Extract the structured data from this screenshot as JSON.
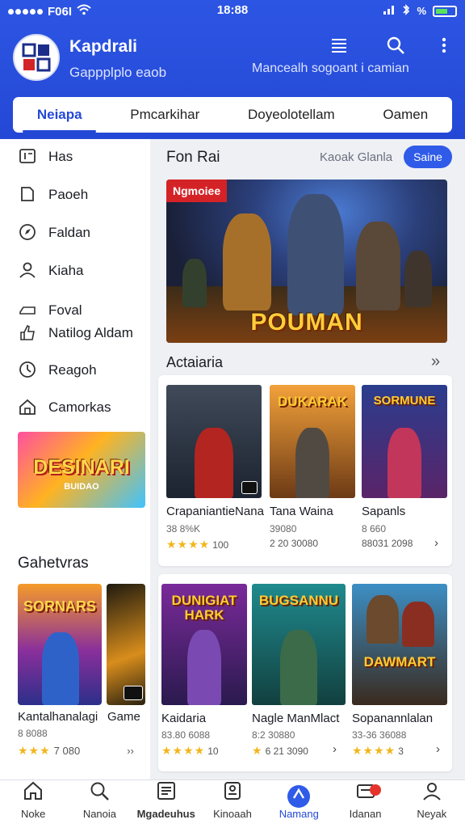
{
  "status_bar": {
    "carrier": "F06I",
    "time": "18:88",
    "battery_text": "%"
  },
  "header": {
    "logo_text": "B B",
    "title": "Kapdrali",
    "subtitle": "Gappplplo eaob",
    "right_text": "Mancealh sogoant i camian",
    "icons": [
      "list-icon",
      "search-icon",
      "more-icon"
    ]
  },
  "tabs": [
    {
      "label": "Neiapa",
      "active": true
    },
    {
      "label": "Pmcarkihar",
      "active": false
    },
    {
      "label": "Doyeolotellam",
      "active": false
    },
    {
      "label": "Oamen",
      "active": false
    }
  ],
  "sidebar": {
    "items": [
      {
        "label": "Has",
        "icon": "list-icon"
      },
      {
        "label": "Paoeh",
        "icon": "tag-icon"
      },
      {
        "label": "Faldan",
        "icon": "compass-icon"
      },
      {
        "label": "Kiaha",
        "icon": "user-icon"
      },
      {
        "label": "Foval",
        "icon": "folder-icon"
      },
      {
        "label": "Natilog Aldam",
        "icon": "thumb-icon"
      },
      {
        "label": "Reagoh",
        "icon": "clock-icon"
      },
      {
        "label": "Camorkas",
        "icon": "home-icon"
      }
    ],
    "banner_title": "DESINARI",
    "banner_sub": "BUIDAO",
    "section_title": "Gahetvras",
    "cards": [
      {
        "label": "Kantalhanalagi",
        "art_title": "SORNARS"
      },
      {
        "label": "Game",
        "art_title": ""
      }
    ],
    "meta": "8 8088",
    "rating_stars": "★★★",
    "rating_text": "7 080",
    "rating_more": "››"
  },
  "main": {
    "section_title": "Fon Rai",
    "section_link": "Kaoak Glanla",
    "pill_label": "Saine",
    "hero": {
      "badge": "Ngmoiee",
      "title": "POUMAN"
    },
    "subsection_title": "Actaiaria",
    "more_icon": "»",
    "row1": [
      {
        "name": "CrapaniantieNana",
        "sub": "38 8%K",
        "stars": "★★★★",
        "rating": "100",
        "art_title": ""
      },
      {
        "name": "Tana Waina",
        "sub": "39080",
        "stars": "",
        "rating": "2 20 30080",
        "art_title": "DUKARAK"
      },
      {
        "name": "Sapanls",
        "sub": "8 660",
        "stars": "",
        "rating": "88031 2098",
        "art_title": "SORMUNE"
      }
    ],
    "row2": [
      {
        "name": "Kaidaria",
        "sub": "83.80 6088",
        "stars": "★★★★",
        "rating": "10",
        "art_title": "DUNIGIAT HARK"
      },
      {
        "name": "Nagle ManMlact",
        "sub": "8:2 30880",
        "stars": "★",
        "rating": "6 21 3090",
        "art_title": "BUGSANNU"
      },
      {
        "name": "Sopanannlalan",
        "sub": "33-36 36088",
        "stars": "★★★★",
        "rating": "3",
        "art_title": "DAWMART"
      }
    ]
  },
  "bottom_nav": [
    {
      "label": "Noke",
      "icon": "home-icon"
    },
    {
      "label": "Nanoia",
      "icon": "search-icon"
    },
    {
      "label": "Mgadeuhus",
      "icon": "news-icon"
    },
    {
      "label": "Kinoaah",
      "icon": "library-icon"
    },
    {
      "label": "Namang",
      "icon": "games-icon",
      "active": true
    },
    {
      "label": "Idanan",
      "icon": "message-icon"
    },
    {
      "label": "Neyak",
      "icon": "profile-icon"
    }
  ]
}
